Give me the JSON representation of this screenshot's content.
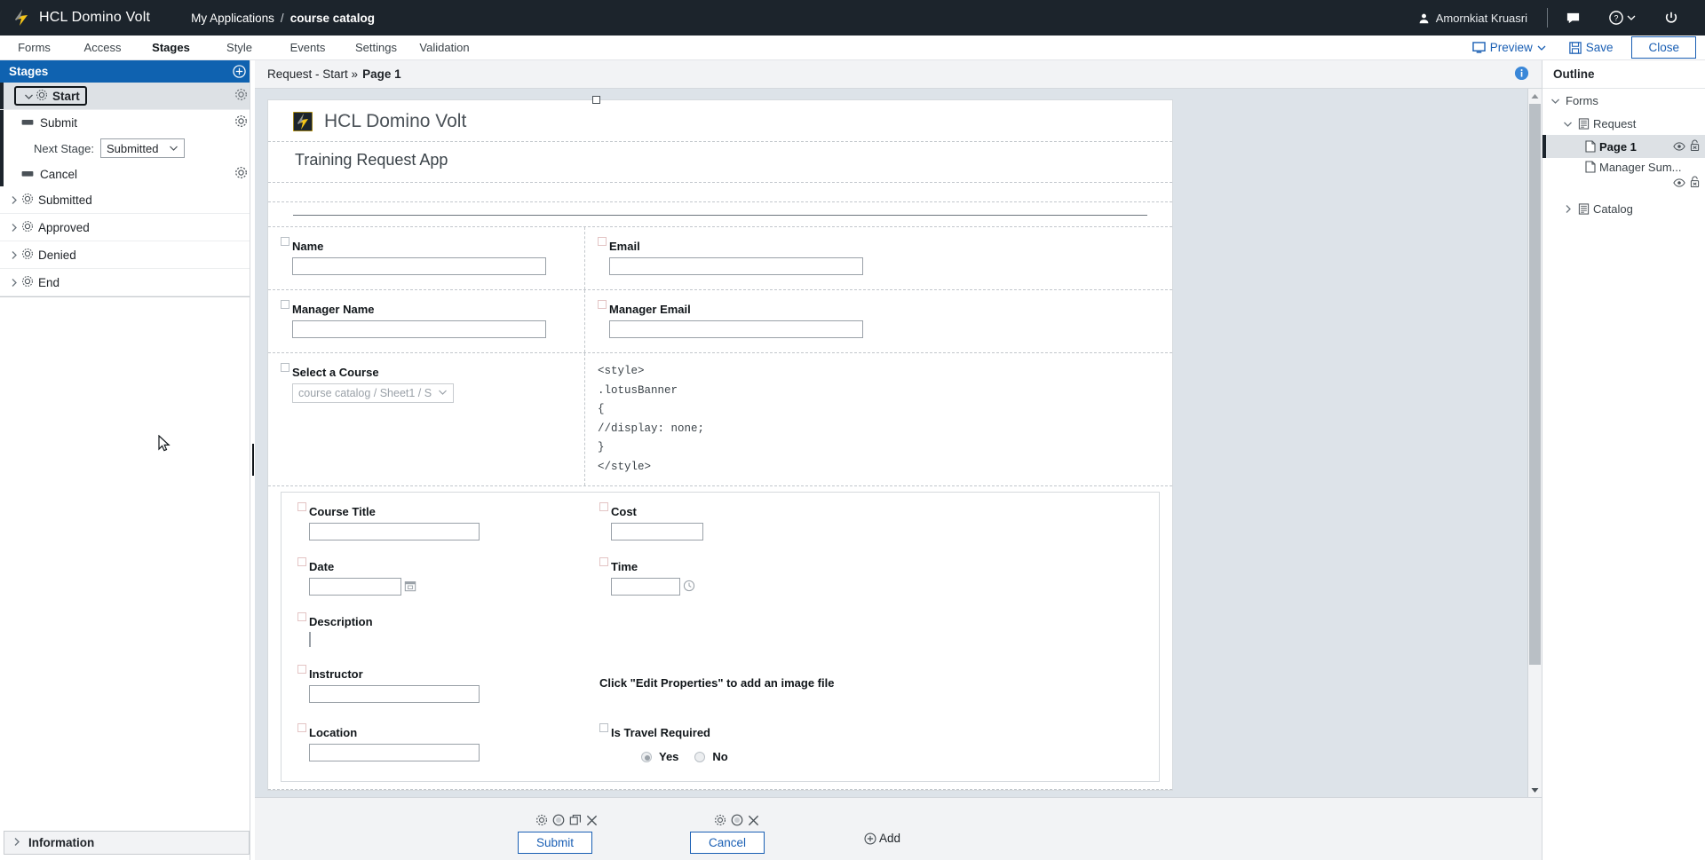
{
  "topbar": {
    "brand": "HCL Domino Volt",
    "breadcrumb_root": "My Applications",
    "breadcrumb_sep": "/",
    "breadcrumb_current": "course catalog",
    "user_name": "Amornkiat Kruasri",
    "icons": [
      "user-icon",
      "chat-icon",
      "help-icon",
      "chevron-down-icon",
      "power-icon"
    ]
  },
  "nav": {
    "tabs": [
      {
        "label": "Forms",
        "active": false
      },
      {
        "label": "Access",
        "active": false
      },
      {
        "label": "Stages",
        "active": true
      },
      {
        "label": "Style",
        "active": false
      },
      {
        "label": "Events",
        "active": false
      },
      {
        "label": "Settings",
        "active": false
      },
      {
        "label": "Validation",
        "active": false
      }
    ],
    "preview_label": "Preview",
    "save_label": "Save",
    "close_label": "Close",
    "accent": "#1a5fb4"
  },
  "stages_panel": {
    "title": "Stages",
    "add_tooltip": "Add stage",
    "selected_stage": "Start",
    "actions": [
      {
        "label": "Submit"
      },
      {
        "label": "Cancel"
      }
    ],
    "next_stage_label": "Next Stage:",
    "next_stage_value": "Submitted",
    "stages": [
      {
        "label": "Submitted"
      },
      {
        "label": "Approved"
      },
      {
        "label": "Denied"
      },
      {
        "label": "End"
      }
    ],
    "information_label": "Information"
  },
  "breadcrumb_bar": {
    "prefix": "Request - Start »",
    "current": "Page 1"
  },
  "form": {
    "brand_title": "HCL Domino Volt",
    "app_title": "Training Request App",
    "fields": [
      {
        "label": "Name",
        "type": "text",
        "required": false
      },
      {
        "label": "Email",
        "type": "text",
        "required": true
      },
      {
        "label": "Manager Name",
        "type": "text",
        "required": false
      },
      {
        "label": "Manager Email",
        "type": "text",
        "required": true
      },
      {
        "label": "Select a Course",
        "type": "select",
        "value": "course catalog / Sheet1 / S",
        "required": false
      }
    ],
    "code_lines": [
      "<style>",
      ".lotusBanner",
      "{",
      "//display: none;",
      "}",
      "</style>"
    ],
    "detail_fields": [
      {
        "label": "Course Title",
        "type": "text"
      },
      {
        "label": "Cost",
        "type": "text-small"
      },
      {
        "label": "Date",
        "type": "date"
      },
      {
        "label": "Time",
        "type": "time"
      },
      {
        "label": "Description",
        "type": "textarea"
      },
      {
        "label": "Instructor",
        "type": "text"
      },
      {
        "label": "Location",
        "type": "text"
      }
    ],
    "image_placeholder_note": "Click \"Edit Properties\" to add an image file",
    "travel": {
      "label": "Is Travel Required",
      "options": [
        {
          "label": "Yes",
          "selected": true
        },
        {
          "label": "No",
          "selected": false
        }
      ]
    }
  },
  "actionbar": {
    "submit_label": "Submit",
    "cancel_label": "Cancel",
    "add_label": "Add"
  },
  "outline": {
    "title": "Outline",
    "root_label": "Forms",
    "request_label": "Request",
    "pages": [
      {
        "label": "Page 1",
        "selected": true
      },
      {
        "label": "Manager Sum...",
        "selected": false
      }
    ],
    "catalog_label": "Catalog"
  }
}
